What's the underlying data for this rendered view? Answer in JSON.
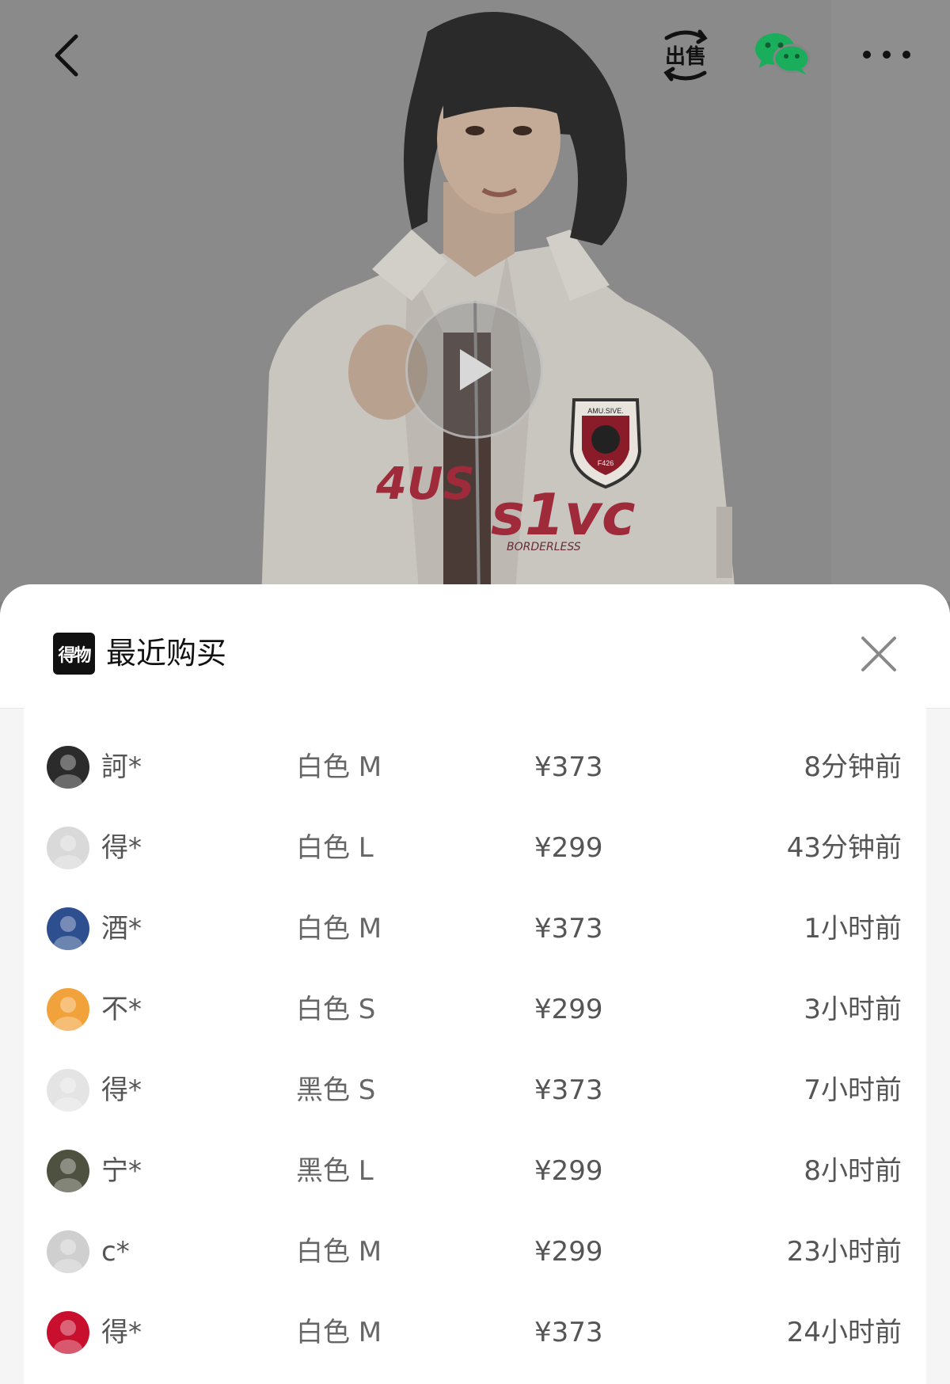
{
  "header": {
    "sell_label": "出售",
    "icons": [
      "back-arrow-icon",
      "sell-icon",
      "wechat-icon",
      "more-icon"
    ]
  },
  "hero": {
    "patch_text": "AMU.SIVE.",
    "patch_code": "F426",
    "jacket_text": "s1vc",
    "jacket_subtext": "BORDERLESS",
    "sleeve_text": "4US"
  },
  "sheet": {
    "logo_text": "得物",
    "title": "最近购买",
    "purchases": [
      {
        "user": "訶*",
        "spec": "白色 M",
        "price": "¥373",
        "time": "8分钟前",
        "avatar_color": "#2b2b2b"
      },
      {
        "user": "得*",
        "spec": "白色 L",
        "price": "¥299",
        "time": "43分钟前",
        "avatar_color": "#d9d9d9"
      },
      {
        "user": "酒*",
        "spec": "白色 M",
        "price": "¥373",
        "time": "1小时前",
        "avatar_color": "#2d4f8f"
      },
      {
        "user": "不*",
        "spec": "白色 S",
        "price": "¥299",
        "time": "3小时前",
        "avatar_color": "#f2a23a"
      },
      {
        "user": "得*",
        "spec": "黑色 S",
        "price": "¥373",
        "time": "7小时前",
        "avatar_color": "#e4e4e4"
      },
      {
        "user": "宁*",
        "spec": "黑色 L",
        "price": "¥299",
        "time": "8小时前",
        "avatar_color": "#4e5140"
      },
      {
        "user": "c*",
        "spec": "白色 M",
        "price": "¥299",
        "time": "23小时前",
        "avatar_color": "#cfcfcf"
      },
      {
        "user": "得*",
        "spec": "白色 M",
        "price": "¥373",
        "time": "24小时前",
        "avatar_color": "#c8102e"
      }
    ]
  }
}
